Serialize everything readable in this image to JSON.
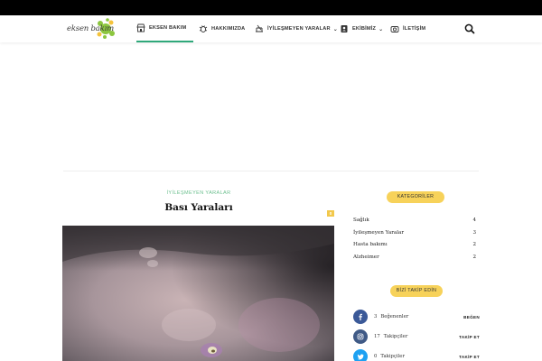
{
  "brand": {
    "logo_text": "eksen bakım"
  },
  "nav": {
    "items": [
      {
        "label": "EKSEN BAKIM",
        "icon": "store-icon",
        "active": true
      },
      {
        "label": "HAKKIMIZDA",
        "icon": "bug-icon"
      },
      {
        "label": "İYİLEŞMEYEN YARALAR",
        "icon": "wound-icon",
        "has_dropdown": true
      },
      {
        "label": "EKİBİMİZ",
        "icon": "team-icon",
        "has_dropdown": true
      },
      {
        "label": "İLETİŞİM",
        "icon": "camera-icon"
      }
    ],
    "search_icon": "search-icon",
    "accent_color": "#2fa87a"
  },
  "post": {
    "category": "İYİLEŞMEYEN YARALAR",
    "title": "Bası Yaraları",
    "comment_count": "0"
  },
  "sidebar": {
    "categories_title": "KATEGORİLER",
    "categories": [
      {
        "name": "Sağlık",
        "count": "4"
      },
      {
        "name": "İyileşmeyen Yaralar",
        "count": "3"
      },
      {
        "name": "Hasta bakımı",
        "count": "2"
      },
      {
        "name": "Alzheimer",
        "count": "2"
      }
    ],
    "follow_title": "BİZİ TAKİP EDİN",
    "social": [
      {
        "network": "facebook",
        "icon": "facebook-icon",
        "count": "3",
        "label": "Beğenenler",
        "action": "BEĞEN",
        "color": "#3b5998"
      },
      {
        "network": "instagram",
        "icon": "instagram-icon",
        "count": "17",
        "label": "Takipçiler",
        "action": "TAKİP ET",
        "color": "#405a86"
      },
      {
        "network": "twitter",
        "icon": "twitter-icon",
        "count": "0",
        "label": "Takipçiler",
        "action": "TAKİP ET",
        "color": "#1da1f2"
      }
    ],
    "pill_color": "#f7d25a"
  }
}
